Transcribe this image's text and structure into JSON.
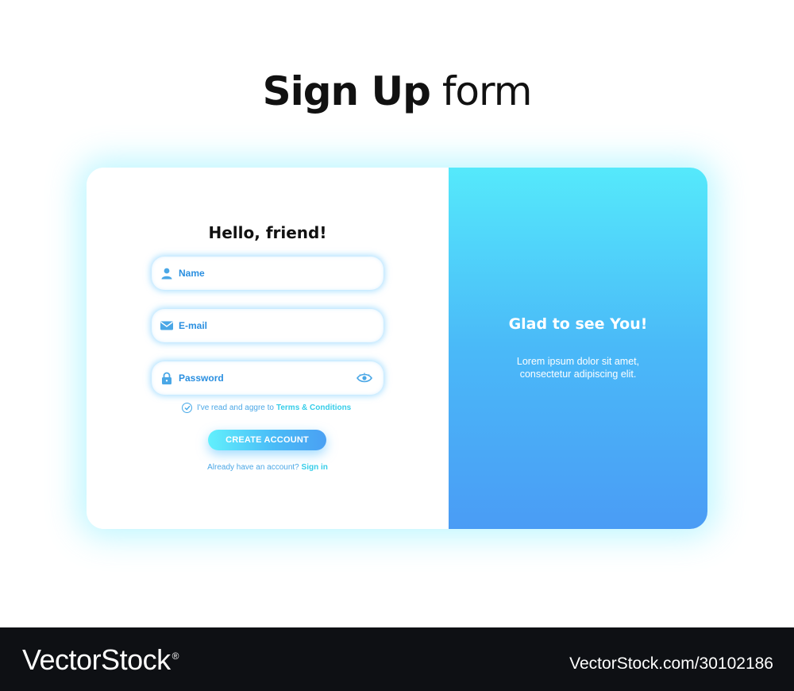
{
  "page": {
    "title_bold": "Sign Up",
    "title_light": "form"
  },
  "left_panel": {
    "heading": "Hello, friend!",
    "fields": {
      "name": {
        "placeholder": "Name",
        "icon": "user-icon"
      },
      "email": {
        "placeholder": "E-mail",
        "icon": "envelope-icon"
      },
      "password": {
        "placeholder": "Password",
        "icon": "lock-icon",
        "toggle_icon": "eye-icon"
      }
    },
    "terms": {
      "text": "I've read and aggre to",
      "link": "Terms &  Conditions",
      "checked": true
    },
    "create_button": "CREATE ACCOUNT",
    "signin": {
      "text": "Already have an account?",
      "link": "Sign in"
    }
  },
  "right_panel": {
    "heading": "Glad to see You!",
    "body_line1": "Lorem ipsum dolor sit amet,",
    "body_line2": "consectetur adipiscing elit."
  },
  "footer": {
    "brand": "VectorStock",
    "registered_mark": "®",
    "url": "VectorStock.com/30102186"
  },
  "colors": {
    "accent_blue": "#4aa7e6",
    "accent_cyan": "#35cde9",
    "panel_gradient_top": "#55e9fb",
    "panel_gradient_bottom": "#4a9cf5",
    "footer_bg": "#0e1014"
  }
}
